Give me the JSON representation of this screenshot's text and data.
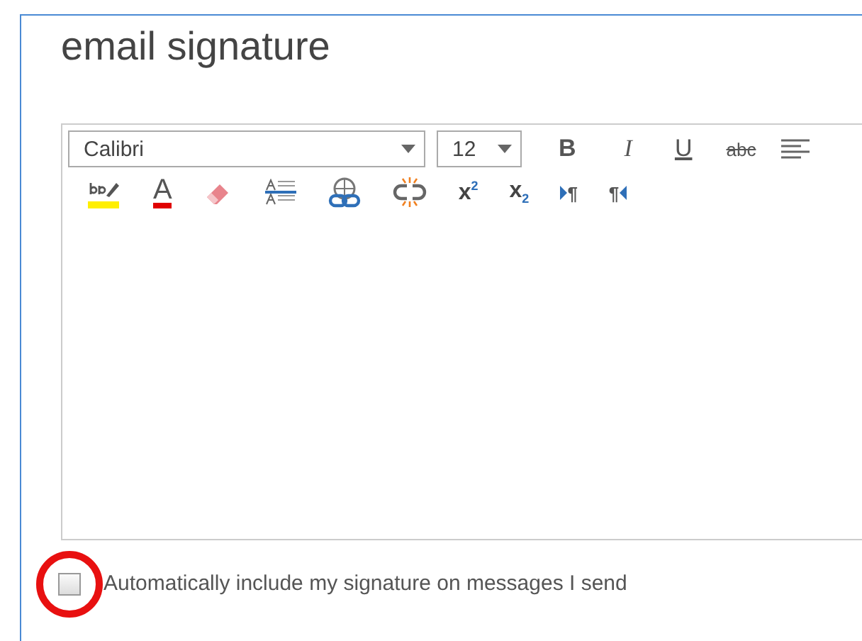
{
  "title": "email signature",
  "font": {
    "value": "Calibri"
  },
  "size": {
    "value": "12"
  },
  "format_buttons": [
    {
      "label": "B",
      "kind": "bold"
    },
    {
      "label": "I",
      "kind": "italic"
    },
    {
      "label": "U",
      "kind": "underline"
    },
    {
      "label": "abc",
      "kind": "strike"
    },
    {
      "kind": "align"
    }
  ],
  "toolbar_row_2": [
    {
      "kind": "highlight"
    },
    {
      "kind": "font-color",
      "label": "A"
    },
    {
      "kind": "eraser"
    },
    {
      "kind": "spacing"
    },
    {
      "kind": "link"
    },
    {
      "kind": "unlink"
    },
    {
      "kind": "script",
      "label": "x$^{2}$"
    },
    {
      "kind": "script",
      "label": "x$_{2}$"
    },
    {
      "kind": "ltr",
      "label": "¶"
    },
    {
      "kind": "rtl",
      "label": "¶"
    }
  ],
  "auto_include": {
    "label": "Automatically include my signature on messages I send",
    "checked": false
  }
}
